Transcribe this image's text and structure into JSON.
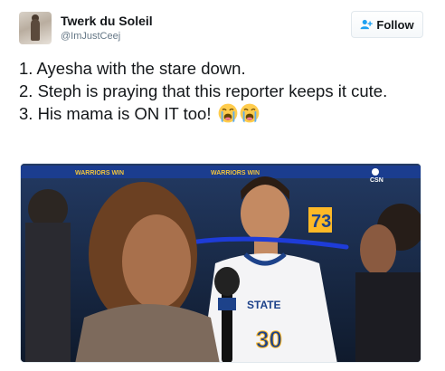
{
  "tweet": {
    "author_name": "Twerk du Soleil",
    "author_handle": "@ImJustCeej",
    "follow_label": "Follow",
    "lines": [
      "1. Ayesha with the stare down.",
      "2. Steph is praying that this reporter keeps it cute.",
      "3. His mama is ON IT too!"
    ],
    "emojis": [
      "loudly-crying-face",
      "loudly-crying-face"
    ]
  },
  "media": {
    "jersey_text": "STATE",
    "jersey_number": "30",
    "shoulder_number": "73",
    "banner_text": "WARRIORS WIN",
    "network_label": "CSN",
    "highlight_color": "#1e3cd8"
  },
  "colors": {
    "follow_icon": "#1da1f2",
    "handle": "#657786",
    "text": "#14171a"
  }
}
